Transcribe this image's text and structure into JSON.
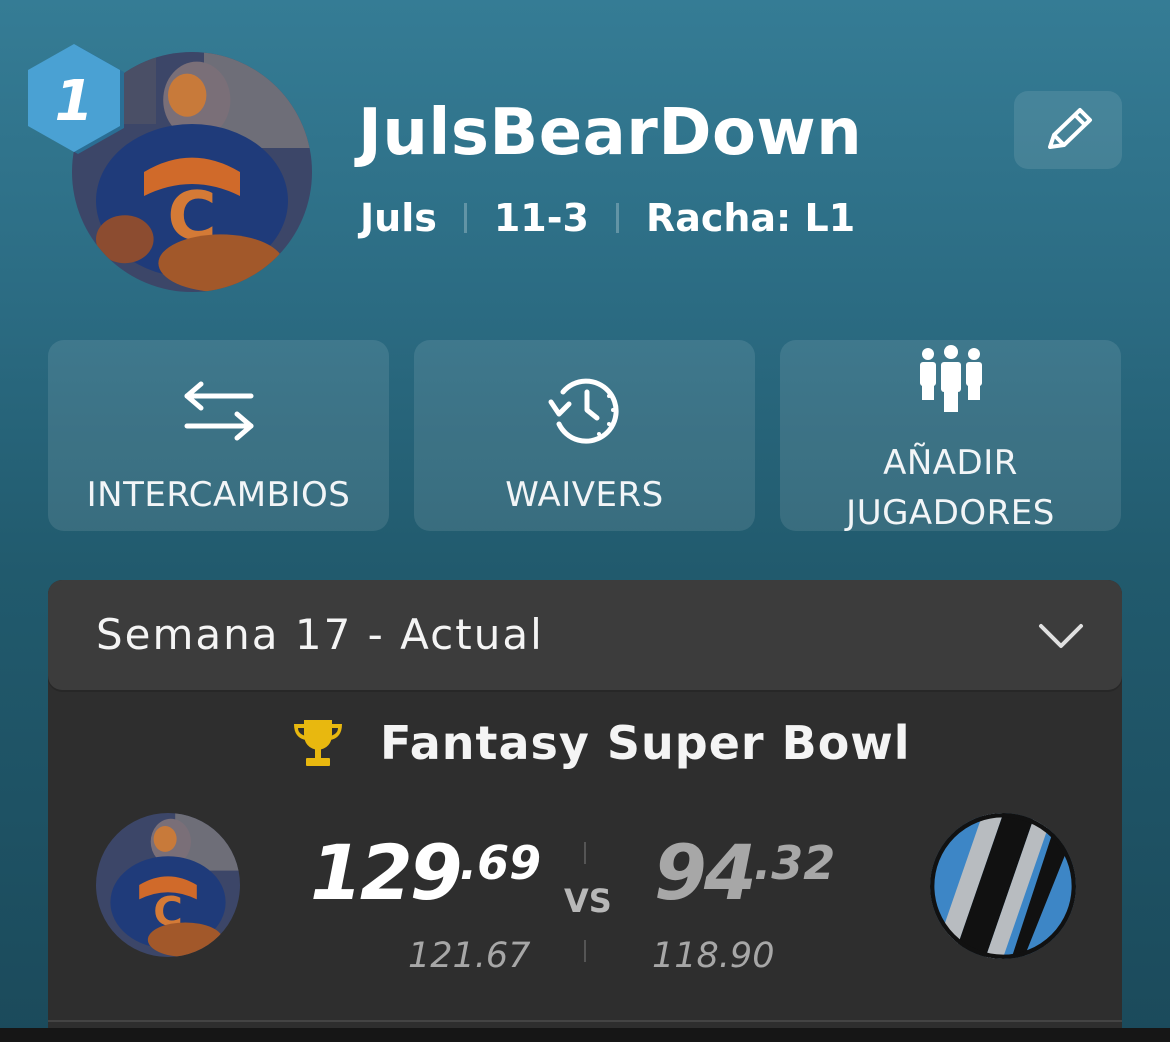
{
  "team": {
    "rank": "1",
    "name": "JulsBearDown",
    "owner": "Juls",
    "record": "11-3",
    "streak": "Racha: L1"
  },
  "actions": [
    {
      "label": "INTERCAMBIOS",
      "icon": "swap-arrows-icon"
    },
    {
      "label": "WAIVERS",
      "icon": "clock-refresh-icon"
    },
    {
      "label": "AÑADIR JUGADORES",
      "icon": "group-people-icon"
    }
  ],
  "week": {
    "label": "Semana 17 - Actual"
  },
  "matchup": {
    "title": "Fantasy Super Bowl",
    "vs_label": "VS",
    "home": {
      "score_whole": "129",
      "score_decimal": ".69",
      "projection": "121.67"
    },
    "away": {
      "score_whole": "94",
      "score_decimal": ".32",
      "projection": "118.90"
    }
  },
  "colors": {
    "trophy": "#e8b80f",
    "away_logo_blue": "#3d86c6",
    "away_logo_black": "#111111",
    "away_logo_silver": "#b8bcc0"
  }
}
